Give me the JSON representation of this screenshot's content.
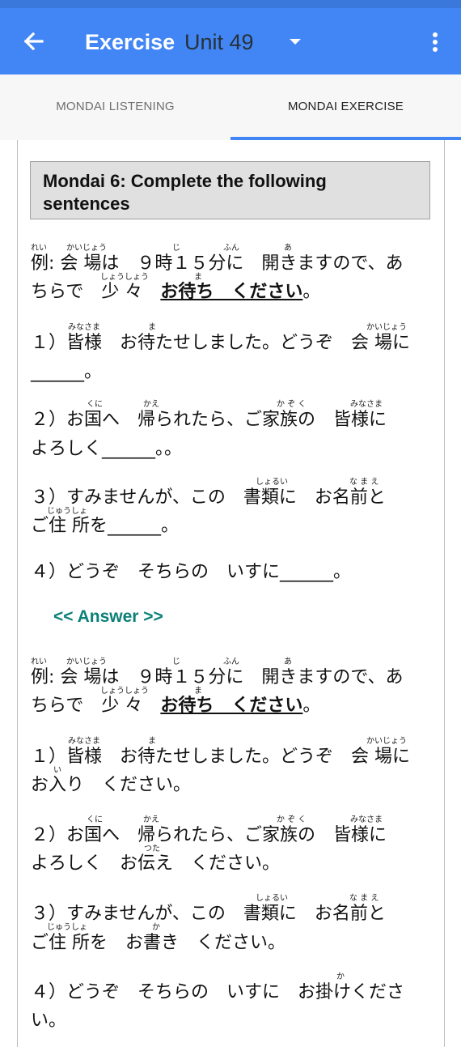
{
  "appbar": {
    "title": "Exercise",
    "unit": "Unit 49",
    "back_icon": "arrow-back-icon",
    "dropdown_icon": "caret-down-icon",
    "menu_icon": "more-vert-icon",
    "color": "#4285f4"
  },
  "tabs": [
    {
      "label": "MONDAI LISTENING",
      "selected": false
    },
    {
      "label": "MONDAI EXERCISE",
      "selected": true
    }
  ],
  "heading": "Mondai 6: Complete the following sentences",
  "exercise": {
    "ex_l1": "例: 会 場は　９時１５分に　開きますので、あ",
    "ex_l2a": "ちらで　少 々　",
    "ex_l2u": "お待ち　ください",
    "ex_l2b": "。",
    "q1_l1": "１）皆様　お待たせしました。どうぞ　会 場に",
    "q1_l2": "______。",
    "q2_l1": "２）お国へ　帰られたら、ご家族の　皆様に",
    "q2_l2": "よろしく______。。",
    "q3_l1": "３）すみませんが、この　書類に　お名前と",
    "q3_l2": "ご住 所を______。",
    "q4_l1": "４）どうぞ　そちらの　いすに______。"
  },
  "answer_link": "<< Answer >>",
  "answers": {
    "ex_l1": "例: 会 場は　９時１５分に　開きますので、あ",
    "ex_l2a": "ちらで　少 々　",
    "ex_l2u": "お待ち　ください",
    "ex_l2b": "。",
    "a1_l1": "１）皆様　お待たせしました。どうぞ　会 場に",
    "a1_l2": "お入り　ください。",
    "a2_l1": "２）お国へ　帰られたら、ご家族の　皆様に",
    "a2_l2": "よろしく　お伝え　ください。",
    "a3_l1": "３）すみませんが、この　書類に　お名前と",
    "a3_l2": "ご住 所を　お書き　ください。",
    "a4_l1": "４）どうぞ　そちらの　いすに　お掛けくださ",
    "a4_l2": "い。"
  },
  "furigana": {
    "rei": "れい",
    "kaijou": "かいじょう",
    "ji": "じ",
    "fun": "ふん",
    "a": "あ",
    "shoushou": "しょうしょう",
    "ma": "ま",
    "minasama": "みなさま",
    "kuni": "くに",
    "kae": "かえ",
    "kazoku": "か ぞ く",
    "shorui": "しょるい",
    "namae": "な ま え",
    "juusho": "じゅうしょ",
    "i": "い",
    "tsuta": "つた",
    "ka": "か"
  }
}
